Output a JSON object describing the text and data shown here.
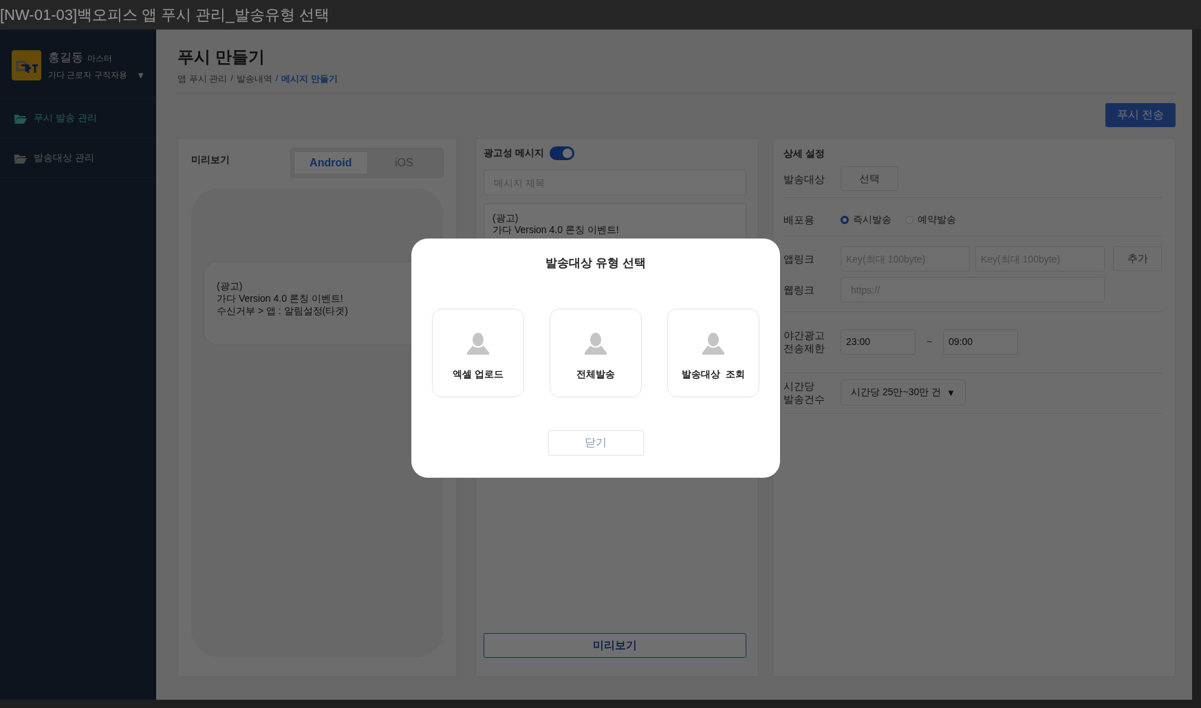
{
  "window": {
    "title": "[NW-01-03]백오피스 앱 푸시 관리_발송유형 선택"
  },
  "sidebar": {
    "user": {
      "name": "홍길동",
      "role": "마스터",
      "org": "가다 근로자 구직자용",
      "caret": "▼"
    },
    "items": [
      {
        "label": "푸시 발송 관리",
        "selected": true
      },
      {
        "label": "발송대상 관리",
        "selected": false
      }
    ]
  },
  "header": {
    "title": "푸시 만들기",
    "breadcrumb": {
      "separator": "/",
      "items": [
        {
          "label": "앱 푸시 관리",
          "current": false
        },
        {
          "label": "발송내역",
          "current": false
        },
        {
          "label": "메시지 만들기",
          "current": true
        }
      ]
    },
    "send_button": "푸시 전송"
  },
  "preview": {
    "title": "미리보기",
    "tabs": [
      {
        "label": "Android",
        "selected": true
      },
      {
        "label": "iOS",
        "selected": false
      }
    ],
    "message_lines": [
      "(광고)",
      "가다 Version 4.0 론칭 이벤트!",
      "수신거부 > 앱 : 알림설정(타겟)"
    ]
  },
  "message": {
    "ad_label": "광고성 메시지",
    "ad_toggle_on": true,
    "title_placeholder": "메시지 제목",
    "body_lines": [
      "(광고)",
      "가다 Version 4.0 론칭 이벤트!"
    ],
    "preview_button": "미리보기"
  },
  "settings": {
    "title": "상세 설정",
    "target": {
      "label": "발송대상",
      "button": "선택"
    },
    "distribution": {
      "label": "배포용",
      "options": [
        {
          "label": "즉시발송",
          "selected": true
        },
        {
          "label": "예약발송",
          "selected": false
        }
      ]
    },
    "app_link": {
      "label": "앱링크",
      "placeholders": [
        "Key(최대 100byte)",
        "Key(최대 100byte)"
      ],
      "add_button": "추가"
    },
    "web_link": {
      "label": "웹링크",
      "placeholder": "https://"
    },
    "night_limit": {
      "label_lines": [
        "야간광고",
        "전송제한"
      ],
      "start": "23:00",
      "separator": "~",
      "end": "09:00"
    },
    "hourly": {
      "label_lines": [
        "시간당",
        "발송건수"
      ],
      "value": "시간당 25만~30만 건",
      "caret": "▼"
    }
  },
  "modal": {
    "title": "발송대상 유형 선택",
    "options": [
      {
        "label": "엑셀 업로드"
      },
      {
        "label": "전체발송"
      },
      {
        "label": "발송대상  조회"
      }
    ],
    "close_button": "닫기"
  }
}
